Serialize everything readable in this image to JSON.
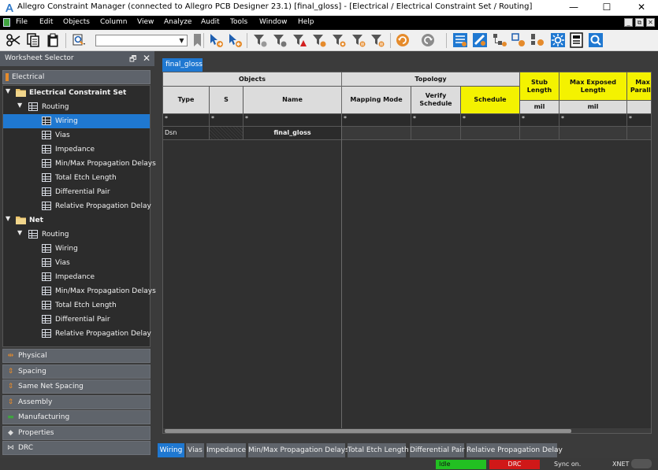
{
  "window": {
    "title": "Allegro Constraint Manager (connected to Allegro PCB Designer 23.1) [final_gloss] - [Electrical / Electrical Constraint Set / Routing]",
    "controls": {
      "minimize": "—",
      "maximize": "☐",
      "close": "✕"
    }
  },
  "menu": {
    "items": [
      "File",
      "Edit",
      "Objects",
      "Column",
      "View",
      "Analyze",
      "Audit",
      "Tools",
      "Window",
      "Help"
    ],
    "mdi_controls": [
      "_",
      "⧉",
      "✕"
    ]
  },
  "toolbar": {
    "icons": [
      "scissors-icon",
      "copy-icon",
      "paste-icon",
      "find-icon",
      "bookmark-icon",
      "filter-icon"
    ],
    "combo_value": ""
  },
  "worksheet_selector": {
    "title": "Worksheet Selector",
    "pin_glyph": "🗗",
    "close_glyph": "✕",
    "active_domain": "Electrical",
    "tree": [
      {
        "label": "Electrical Constraint Set",
        "type": "folder",
        "level": 0,
        "bold": true
      },
      {
        "label": "Routing",
        "type": "table",
        "level": 1
      },
      {
        "label": "Wiring",
        "type": "sheet",
        "level": 2,
        "selected": true
      },
      {
        "label": "Vias",
        "type": "sheet",
        "level": 2
      },
      {
        "label": "Impedance",
        "type": "sheet",
        "level": 2
      },
      {
        "label": "Min/Max Propagation Delays",
        "type": "sheet",
        "level": 2
      },
      {
        "label": "Total Etch Length",
        "type": "sheet",
        "level": 2
      },
      {
        "label": "Differential Pair",
        "type": "sheet",
        "level": 2
      },
      {
        "label": "Relative Propagation Delay",
        "type": "sheet",
        "level": 2
      },
      {
        "label": "Net",
        "type": "folder",
        "level": 0,
        "bold": true
      },
      {
        "label": "Routing",
        "type": "table",
        "level": 1
      },
      {
        "label": "Wiring",
        "type": "sheet",
        "level": 2
      },
      {
        "label": "Vias",
        "type": "sheet",
        "level": 2
      },
      {
        "label": "Impedance",
        "type": "sheet",
        "level": 2
      },
      {
        "label": "Min/Max Propagation Delays",
        "type": "sheet",
        "level": 2
      },
      {
        "label": "Total Etch Length",
        "type": "sheet",
        "level": 2
      },
      {
        "label": "Differential Pair",
        "type": "sheet",
        "level": 2
      },
      {
        "label": "Relative Propagation Delay",
        "type": "sheet",
        "level": 2
      }
    ],
    "domains": [
      {
        "label": "Physical",
        "icon": "physical-icon",
        "glyph": "⇹",
        "color": "#e58b2c"
      },
      {
        "label": "Spacing",
        "icon": "spacing-icon",
        "glyph": "⇕",
        "color": "#e58b2c"
      },
      {
        "label": "Same Net Spacing",
        "icon": "same-net-spacing-icon",
        "glyph": "⇕",
        "color": "#e58b2c"
      },
      {
        "label": "Assembly",
        "icon": "assembly-icon",
        "glyph": "⇕",
        "color": "#e58b2c"
      },
      {
        "label": "Manufacturing",
        "icon": "manufacturing-icon",
        "glyph": "▬",
        "color": "#3fa33f"
      },
      {
        "label": "Properties",
        "icon": "properties-icon",
        "glyph": "◆",
        "color": "#dddddd"
      },
      {
        "label": "DRC",
        "icon": "drc-icon",
        "glyph": "⋈",
        "color": "#dddddd"
      }
    ]
  },
  "document_tab": "final_gloss",
  "grid": {
    "groups": {
      "objects": "Objects",
      "topology": "Topology",
      "stub_length": "Stub Length",
      "max_exposed_length": "Max Exposed Length",
      "max_parallel": "Max Paralle"
    },
    "columns": {
      "type": "Type",
      "s": "S",
      "name": "Name",
      "mapping_mode": "Mapping Mode",
      "verify_schedule": "Verify Schedule",
      "schedule": "Schedule"
    },
    "units": {
      "stub_length": "mil",
      "max_exposed_length": "mil"
    },
    "filter_glyph": "*",
    "rows": [
      {
        "type": "Dsn",
        "s": "",
        "name": "final_gloss",
        "mapping_mode": "",
        "verify_schedule": "",
        "schedule": "",
        "stub_length": "",
        "max_exposed_length": "",
        "max_parallel": ""
      }
    ]
  },
  "bottom_tabs": [
    "Wiring",
    "Vias",
    "Impedance",
    "Min/Max Propagation Delays",
    "Total Etch Length",
    "Differential Pair",
    "Relative Propagation Delay"
  ],
  "active_bottom_tab": "Wiring",
  "status": {
    "idle": "Idle",
    "drc": "DRC",
    "sync": "Sync on.",
    "xnet": "XNET",
    "colors": {
      "idle": "#22c022",
      "drc": "#d01818"
    }
  }
}
